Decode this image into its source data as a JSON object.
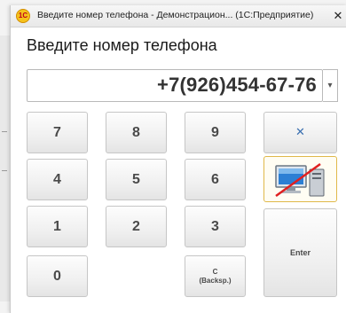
{
  "window": {
    "title": "Введите номер телефона - Демонстрацион... (1С:Предприятие)",
    "app_icon_glyph": "1С",
    "close_glyph": "✕"
  },
  "heading": "Введите номер телефона",
  "phone": {
    "value": "+7(926)454-67-76",
    "dropdown_glyph": "▾"
  },
  "keypad": {
    "k7": "7",
    "k8": "8",
    "k9": "9",
    "clear_glyph": "✕",
    "k4": "4",
    "k5": "5",
    "k6": "6",
    "k1": "1",
    "k2": "2",
    "k3": "3",
    "enter": "Enter",
    "k0": "0",
    "backspace_line1": "C",
    "backspace_line2": "(Backsp.)"
  },
  "colors": {
    "clear_icon": "#3a6fb0",
    "monitor_screen": "#2c7fd4",
    "strike": "#e02020"
  },
  "icons": [
    "close-icon",
    "dropdown-arrow-icon",
    "clear-icon",
    "monitor-disabled-icon"
  ]
}
